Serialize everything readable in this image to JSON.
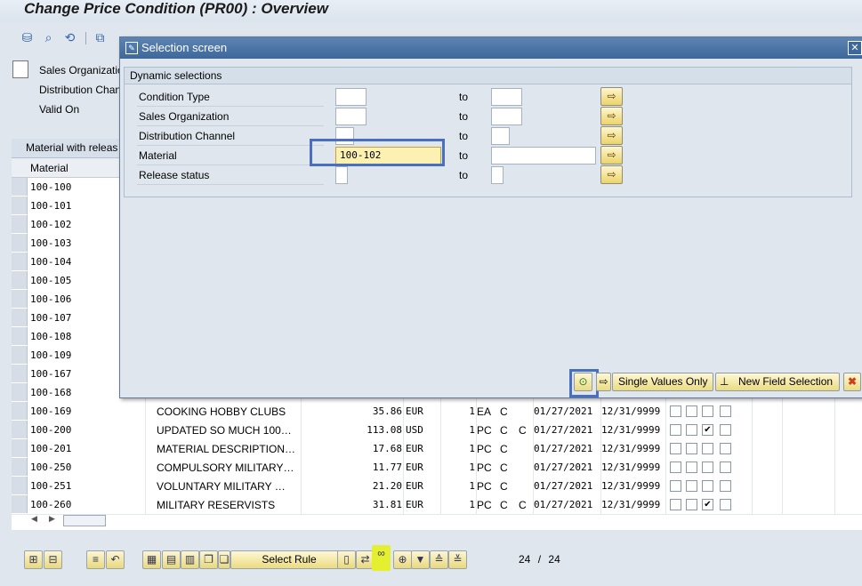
{
  "window": {
    "title": "Change Price Condition (PR00) : Overview"
  },
  "header_fields": {
    "sales_org_label": "Sales Organizatio",
    "dist_channel_label": "Distribution Chan",
    "valid_on_label": "Valid On"
  },
  "grid": {
    "caption": "Material with releas",
    "col_material": "Material",
    "rows": [
      {
        "material": "100-100"
      },
      {
        "material": "100-101"
      },
      {
        "material": "100-102"
      },
      {
        "material": "100-103"
      },
      {
        "material": "100-104"
      },
      {
        "material": "100-105"
      },
      {
        "material": "100-106"
      },
      {
        "material": "100-107"
      },
      {
        "material": "100-108"
      },
      {
        "material": "100-109"
      },
      {
        "material": "100-167"
      },
      {
        "material": "100-168"
      },
      {
        "material": "100-169",
        "desc": "COOKING HOBBY CLUBS",
        "amount": "35.86",
        "curr": "EUR",
        "per": "1",
        "uom": "EA",
        "c1": "C",
        "c2": "",
        "valid_from": "01/27/2021",
        "valid_to": "12/31/9999",
        "checked": [
          false,
          false,
          false,
          false
        ]
      },
      {
        "material": "100-200",
        "desc": "UPDATED SO MUCH 100…",
        "amount": "113.08",
        "curr": "USD",
        "per": "1",
        "uom": "PC",
        "c1": "C",
        "c2": "C",
        "valid_from": "01/27/2021",
        "valid_to": "12/31/9999",
        "checked": [
          false,
          false,
          true,
          false
        ]
      },
      {
        "material": "100-201",
        "desc": "MATERIAL DESCRIPTION…",
        "amount": "17.68",
        "curr": "EUR",
        "per": "1",
        "uom": "PC",
        "c1": "C",
        "c2": "",
        "valid_from": "01/27/2021",
        "valid_to": "12/31/9999",
        "checked": [
          false,
          false,
          false,
          false
        ]
      },
      {
        "material": "100-250",
        "desc": "COMPULSORY MILITARY…",
        "amount": "11.77",
        "curr": "EUR",
        "per": "1",
        "uom": "PC",
        "c1": "C",
        "c2": "",
        "valid_from": "01/27/2021",
        "valid_to": "12/31/9999",
        "checked": [
          false,
          false,
          false,
          false
        ]
      },
      {
        "material": "100-251",
        "desc": "VOLUNTARY MILITARY …",
        "amount": "21.20",
        "curr": "EUR",
        "per": "1",
        "uom": "PC",
        "c1": "C",
        "c2": "",
        "valid_from": "01/27/2021",
        "valid_to": "12/31/9999",
        "checked": [
          false,
          false,
          false,
          false
        ]
      },
      {
        "material": "100-260",
        "desc": "MILITARY RESERVISTS",
        "amount": "31.81",
        "curr": "EUR",
        "per": "1",
        "uom": "PC",
        "c1": "C",
        "c2": "C",
        "valid_from": "01/27/2021",
        "valid_to": "12/31/9999",
        "checked": [
          false,
          false,
          true,
          false
        ]
      }
    ]
  },
  "bottom_bar": {
    "select_rule_label": "Select Rule",
    "page_current": "24",
    "page_sep": "/",
    "page_total": "24"
  },
  "dialog": {
    "title": "Selection screen",
    "group_caption": "Dynamic selections",
    "fields": [
      {
        "label": "Condition Type",
        "from": "",
        "to_label": "to",
        "to": ""
      },
      {
        "label": "Sales Organization",
        "from": "",
        "to_label": "to",
        "to": ""
      },
      {
        "label": "Distribution Channel",
        "from": "",
        "to_label": "to",
        "to": ""
      },
      {
        "label": "Material",
        "from": "100-102",
        "to_label": "to",
        "to": ""
      },
      {
        "label": "Release status",
        "from": "",
        "to_label": "to",
        "to": ""
      }
    ],
    "single_values_label": "Single Values Only",
    "new_field_selection_label": "New Field Selection"
  },
  "colors": {
    "highlight_border": "#4a6fc0",
    "highlight_yellow": "#e4ef2f",
    "dialog_title": "#3e689b"
  }
}
